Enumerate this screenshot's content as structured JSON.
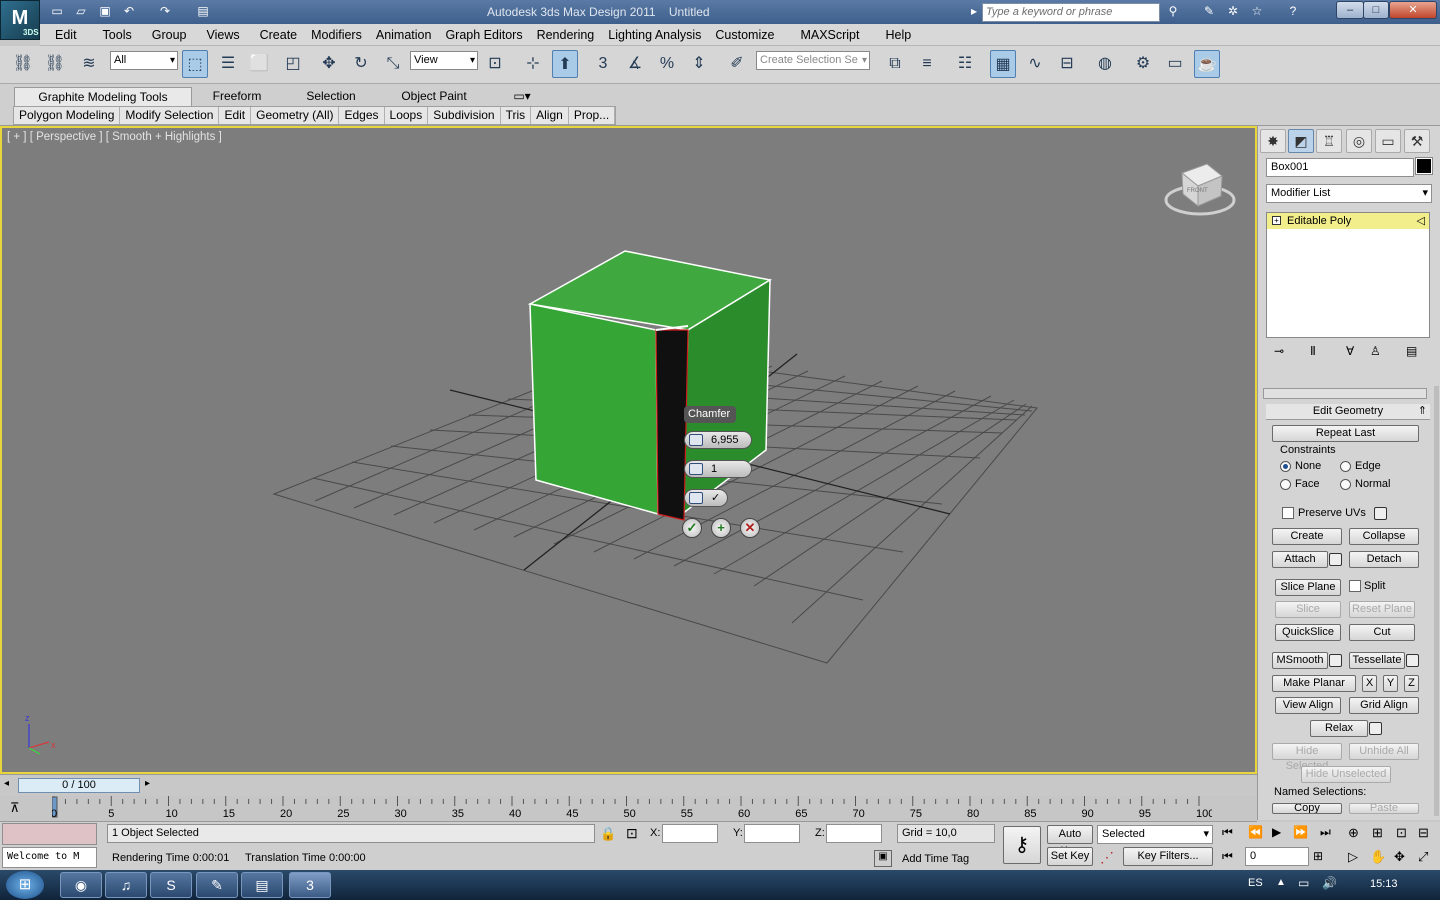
{
  "app": {
    "title": "Autodesk 3ds Max Design 2011",
    "file": "Untitled",
    "search_placeholder": "Type a keyword or phrase",
    "logo": "M",
    "logo_sub": "3DS"
  },
  "menu": [
    "Edit",
    "Tools",
    "Group",
    "Views",
    "Create",
    "Modifiers",
    "Animation",
    "Graph Editors",
    "Rendering",
    "Lighting Analysis",
    "Customize",
    "MAXScript",
    "Help"
  ],
  "toolbar": {
    "filter": "All",
    "ref_coord": "View",
    "named_selection_placeholder": "Create Selection Se"
  },
  "ribbon": {
    "tabs": [
      "Graphite Modeling Tools",
      "Freeform",
      "Selection",
      "Object Paint"
    ],
    "panels": [
      "Polygon Modeling",
      "Modify Selection",
      "Edit",
      "Geometry (All)",
      "Edges",
      "Loops",
      "Subdivision",
      "Tris",
      "Align",
      "Prop..."
    ]
  },
  "viewport": {
    "label": "[ + ] [ Perspective ] [ Smooth + Highlights ]",
    "cube_label": "FRONT"
  },
  "caddy": {
    "title": "Chamfer",
    "amount": "6,955",
    "segments": "1"
  },
  "command_panel": {
    "object_name": "Box001",
    "modifier_list": "Modifier List",
    "stack_item": "Editable Poly",
    "rollout_title": "Edit Geometry",
    "repeat_last": "Repeat Last",
    "constraints_label": "Constraints",
    "constraints": {
      "none": "None",
      "edge": "Edge",
      "face": "Face",
      "normal": "Normal"
    },
    "preserve_uvs": "Preserve UVs",
    "create": "Create",
    "collapse": "Collapse",
    "attach": "Attach",
    "detach": "Detach",
    "slice_plane": "Slice Plane",
    "split": "Split",
    "slice": "Slice",
    "reset_plane": "Reset Plane",
    "quickslice": "QuickSlice",
    "cut": "Cut",
    "msmooth": "MSmooth",
    "tessellate": "Tessellate",
    "make_planar": "Make Planar",
    "x": "X",
    "y": "Y",
    "z": "Z",
    "view_align": "View Align",
    "grid_align": "Grid Align",
    "relax": "Relax",
    "hide_selected": "Hide Selected",
    "unhide_all": "Unhide All",
    "hide_unselected": "Hide Unselected",
    "named_selections": "Named Selections:",
    "copy": "Copy",
    "paste": "Paste"
  },
  "timeline": {
    "frame": "0 / 100",
    "ticks": [
      "0",
      "5",
      "10",
      "15",
      "20",
      "25",
      "30",
      "35",
      "40",
      "45",
      "50",
      "55",
      "60",
      "65",
      "70",
      "75",
      "80",
      "85",
      "90",
      "95",
      "100"
    ]
  },
  "status": {
    "selected": "1 Object Selected",
    "rendering_time": "Rendering Time  0:00:01",
    "translation_time": "Translation Time  0:00:00",
    "welcome": "Welcome to M",
    "x_label": "X:",
    "y_label": "Y:",
    "z_label": "Z:",
    "grid": "Grid = 10,0",
    "add_time_tag": "Add Time Tag",
    "auto_key": "Auto Key",
    "set_key": "Set Key",
    "key_mode": "Selected",
    "key_filters": "Key Filters...",
    "frame_field": "0"
  },
  "taskbar": {
    "lang": "ES",
    "time": "15:13"
  }
}
